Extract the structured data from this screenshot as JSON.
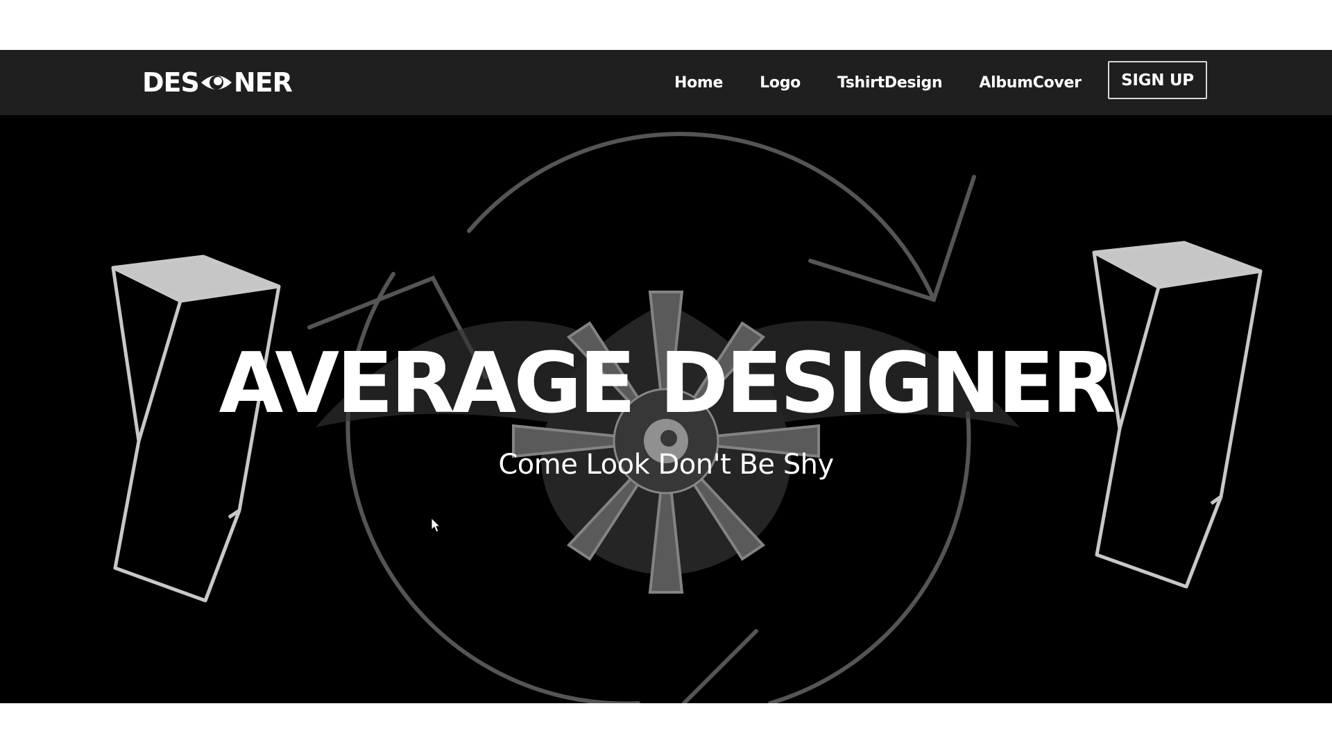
{
  "navbar": {
    "logo_text_left": "DES",
    "logo_text_right": "NER",
    "logo_icon": "eye-icon",
    "links": [
      "Home",
      "Logo",
      "TshirtDesign",
      "AlbumCover"
    ],
    "signup_label": "SIGN UP"
  },
  "hero": {
    "title": "AVERAGE DESIGNER",
    "subtitle": "Come Look Don't Be Shy",
    "background_art": "line-art-pillars-circle-flower-eye"
  },
  "colors": {
    "navbar_bg": "#1f1f1f",
    "hero_bg": "#000000",
    "text": "#ffffff",
    "line_art": "#bdbdbd"
  }
}
